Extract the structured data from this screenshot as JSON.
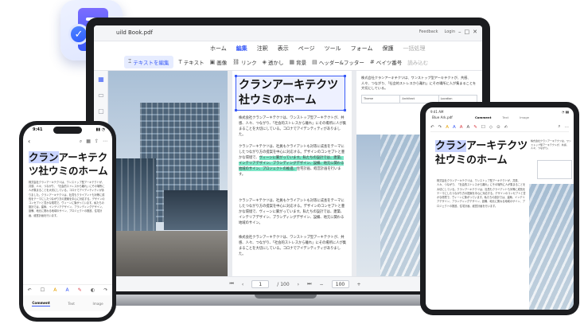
{
  "app_icon": {
    "name": "pdf-editor-app-icon"
  },
  "laptop": {
    "doc_title": "uild Book.pdf",
    "menu": [
      "ホーム",
      "編集",
      "注釈",
      "表示",
      "ページ",
      "ツール",
      "フォーム",
      "保護",
      "一括処理"
    ],
    "active_menu": "編集",
    "title_right": [
      "Feedback",
      "Login"
    ],
    "toolbar": {
      "edit_mode": "テキストを編集",
      "text": "テキスト",
      "image": "画像",
      "link": "リンク",
      "watermark": "透かし",
      "background": "背景",
      "header_footer": "ヘッダー&フッター",
      "bates": "ベイツ番号",
      "read_only": "読み込む"
    },
    "heading": [
      "クランアーキテクツ",
      "社ウミのホーム"
    ],
    "para1": "株式会社クランアーキテクツは、ワンストップ型アーキテクトが、共感、人々、つながり、「社会的ストレスから離れ」にその場所に人が集まることを大切にしている。コロナでアイデンティティがありました。",
    "para2_pre": "クランアーキテクツは、社員もクライアントも対等に成長をテーマにしたつながり方の提案を中心に対応する。デザインのコンセプトと豊かな環境で、",
    "para2_hl": "ヴィーンに繋がっています。私たちの設計では、建築、インテリアデザイン、ブランディングデザイン、設備、地元に関わる地域のサイン、プロジェクトの推進、",
    "para2_post": "住宅計画、経営計画を行います。",
    "para3": "クランアーキテクツは、社員もクライアントも対等に成長をテーマにしたつながり方の提案を中心に対応する。デザインのコンセプトと豊かな環境で、ヴィーンに繋がっています。私たちの設計では、建築、インテリアデザイン、ブランディングデザイン、設備、地元に関わる地域のサイン。",
    "right_text": "株式会社クランアーキテクツは、ワンストップ型アーキテクトが、共感、人々、つながり、「社会的ストレスから離れ」にその場所に人が集まることを大切にしている。",
    "table": [
      "Theme",
      "Architect",
      "Location"
    ],
    "status": {
      "page_current": "1",
      "page_total": "/ 100",
      "zoom": "100"
    }
  },
  "phone": {
    "time": "9:41",
    "heading": [
      "クランアーキテク",
      "ツ社ウミのホーム"
    ],
    "heading_sel": "クラン",
    "body": "株式会社クランアーキテクツは、ワンストップ型アーキテクトが、共感、人々、つながり、「社会的ストレスから離れ」にその場所に人が集まることを大切にしている。コロナでアイデンティティがありました。クランアーキテクツは、社員もクライアントも対等に成長をテーマにしたつながり方の提案を中心に対応する。デザインのコンセプトと豊かな環境で、ヴィーンに繋がっています。私たちの設計では、建築、インテリアデザイン、ブランディングデザイン、設備、地元に関わる地域のサイン、プロジェクトの推進、住宅計画、経営計画を行います。",
    "tabs": [
      "Comment",
      "Text",
      "Image"
    ],
    "active_tab": "Comment"
  },
  "tablet": {
    "time": "9:41 AM",
    "title": "Blue Ark.pdf",
    "tabs": [
      "Comment",
      "Text",
      "Image"
    ],
    "active_tab": "Comment",
    "heading": [
      "クランアーキテクツ",
      "社ウミのホーム"
    ],
    "heading_sel": "クラン",
    "body": "株式会社クランアーキテクツは、ワンストップ型アーキテクトが、共感、人々、つながり、「社会的ストレスから離れ」にその場所に人が集まることを大切にしている。クランアーキテクツは、社員もクライアントも対等に成長をテーマにしたつながり方の提案を中心に対応する。デザインのコンセプトと豊かな環境で、ヴィーンに繋がっています。私たちの設計では、建築、インテリアデザイン、ブランディングデザイン、設備、地元に関わる地域のサイン、プロジェクトの推進、住宅計画、経営計画を行います。",
    "side_text": "株式会社クランアーキテクツは、ワンストップ型アーキテクトが、共感、人々、つながり。"
  },
  "colors": {
    "accent": "#3a5bf7",
    "highlight": "#7fe7c8"
  }
}
